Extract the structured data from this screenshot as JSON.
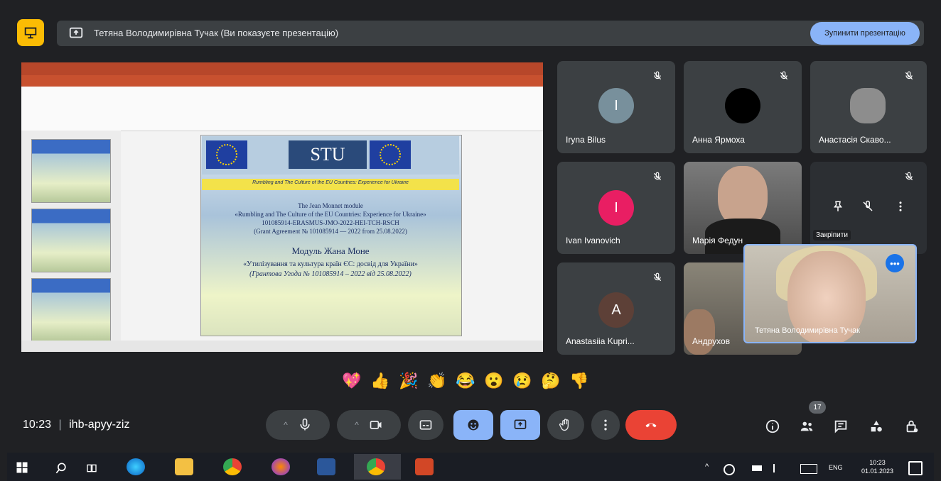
{
  "banner": {
    "presenter_text": "Тетяна Володимирівна Тучак (Ви показуєте презентацію)",
    "stop_button": "Зупинити презентацію"
  },
  "slide": {
    "logo_text": "STU",
    "subtitle": "Rumbling and The Culture of the EU Countries: Experience for Ukraine",
    "lines": [
      "The Jean Monnet module",
      "«Rumbling and The Culture of the EU Countries: Experience for Ukraine»",
      "101085914-ERASMUS-JMO-2022-HEI-TCH-RSCH",
      "(Grant Agreement № 101085914 — 2022 from 25.08.2022)",
      "Модуль Жана Моне",
      "«Утилізування та культура країн ЄС: досвід для України»",
      "(Грантова Угода № 101085914 – 2022 від 25.08.2022)"
    ]
  },
  "participants": [
    {
      "name": "Iryna Bilus",
      "avatar_letter": "I",
      "avatar_color": "#78909c",
      "muted": true
    },
    {
      "name": "Анна Ярмоха",
      "avatar_letter": "",
      "avatar_color": "#000000",
      "muted": true
    },
    {
      "name": "Анастасія Скаво...",
      "avatar_letter": "",
      "avatar_color": "#5f6368",
      "muted": true
    },
    {
      "name": "Ivan Ivanovich",
      "avatar_letter": "I",
      "avatar_color": "#e91e63",
      "muted": true
    },
    {
      "name": "Марія Федун",
      "avatar_letter": "",
      "avatar_color": "#5f6368",
      "muted": false
    },
    {
      "name": "Закріпити",
      "avatar_letter": "",
      "avatar_color": "#5f6368",
      "muted": true
    },
    {
      "name": "Anastasiia Kupri...",
      "avatar_letter": "A",
      "avatar_color": "#5d4037",
      "muted": true
    },
    {
      "name": "Андрухов",
      "avatar_letter": "",
      "avatar_color": "#5f6368",
      "muted": false
    }
  ],
  "self_view": {
    "name": "Тетяна Володимирівна Тучак",
    "more_label": "•••"
  },
  "reactions": [
    "💖",
    "👍",
    "🎉",
    "👏",
    "😂",
    "😮",
    "😢",
    "🤔",
    "👎"
  ],
  "meeting": {
    "time": "10:23",
    "separator": "|",
    "code": "ihb-apyy-ziz"
  },
  "people_count": "17",
  "taskbar": {
    "time": "10:23",
    "date": "01.01.2023",
    "lang": "ENG"
  },
  "colors": {
    "background": "#202124",
    "accent": "#8ab4f8",
    "end_call": "#ea4335",
    "logo": "#fbbc04"
  }
}
